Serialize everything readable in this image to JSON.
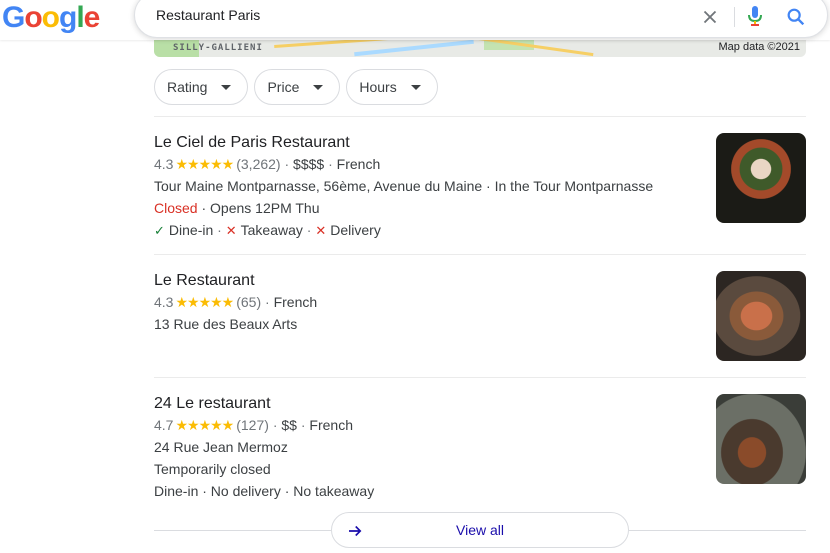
{
  "search": {
    "logo_letters": [
      "G",
      "o",
      "o",
      "g",
      "l",
      "e"
    ],
    "logo_colors": [
      "#4285f4",
      "#ea4335",
      "#fbbc05",
      "#4285f4",
      "#34a853",
      "#ea4335"
    ],
    "query": "Restaurant Paris",
    "icons": [
      "close-icon",
      "mic-icon",
      "search-icon"
    ]
  },
  "map": {
    "area_label": "SILLY-GALLIENI",
    "credit": "Map data ©2021"
  },
  "filters": [
    {
      "label": "Rating"
    },
    {
      "label": "Price"
    },
    {
      "label": "Hours"
    }
  ],
  "listings": [
    {
      "name": "Le Ciel de Paris Restaurant",
      "rating": "4.3",
      "stars": "★★★★★",
      "reviews": "(3,262)",
      "price": "$$$$",
      "cuisine": "French",
      "address": "Tour Maine Montparnasse, 56ème, Avenue du Maine · In the Tour Montparnasse",
      "status": "Closed",
      "status_extra": "· Opens 12PM Thu",
      "services": {
        "dine_in": "Dine-in",
        "takeaway": "Takeaway",
        "delivery": "Delivery"
      }
    },
    {
      "name": "Le Restaurant",
      "rating": "4.3",
      "stars": "★★★★★",
      "reviews": "(65)",
      "cuisine": "French",
      "address": "13 Rue des Beaux Arts"
    },
    {
      "name": "24 Le restaurant",
      "rating": "4.7",
      "stars": "★★★★★",
      "reviews": "(127)",
      "price": "$$",
      "cuisine": "French",
      "address": "24 Rue Jean Mermoz",
      "status": "Temporarily closed",
      "services_text": "Dine-in · No delivery · No takeaway"
    }
  ],
  "view_all": "View all",
  "colors": {
    "accent": "#1a73e8",
    "star": "#fbbc04",
    "closed": "#d93025",
    "check": "#188038",
    "link": "#1a0dab"
  }
}
